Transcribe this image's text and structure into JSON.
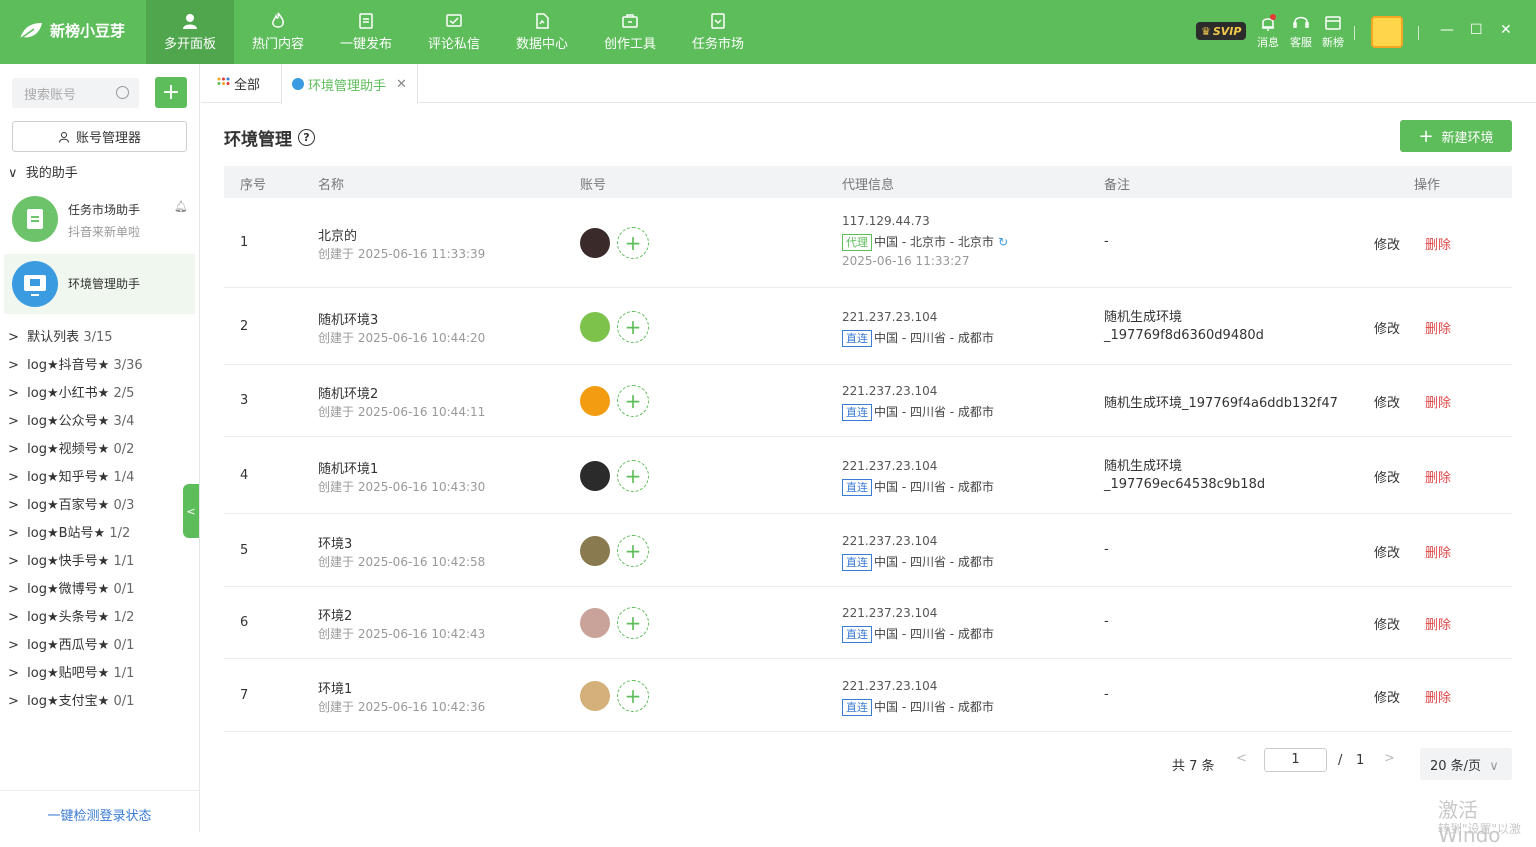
{
  "app": {
    "name": "新榜小豆芽"
  },
  "nav": [
    {
      "label": "多开面板",
      "icon": "user-icon",
      "active": true
    },
    {
      "label": "热门内容",
      "icon": "flame-icon"
    },
    {
      "label": "一键发布",
      "icon": "publish-icon"
    },
    {
      "label": "评论私信",
      "icon": "message-icon"
    },
    {
      "label": "数据中心",
      "icon": "data-icon"
    },
    {
      "label": "创作工具",
      "icon": "toolbox-icon"
    },
    {
      "label": "任务市场",
      "icon": "task-icon"
    }
  ],
  "topright": {
    "svip": "SVIP",
    "msg": "消息",
    "service": "客服",
    "newbang": "新榜"
  },
  "sidebar": {
    "search_placeholder": "搜索账号",
    "add": "+",
    "account_manager": "账号管理器",
    "my_helpers": "我的助手",
    "helpers": [
      {
        "title": "任务市场助手",
        "subtitle": "抖音来新单啦"
      },
      {
        "title": "环境管理助手",
        "subtitle": ""
      }
    ],
    "groups": [
      {
        "name": "默认列表",
        "count": "3/15"
      },
      {
        "name": "log★抖音号★",
        "count": "3/36"
      },
      {
        "name": "log★小红书★",
        "count": "2/5"
      },
      {
        "name": "log★公众号★",
        "count": "3/4"
      },
      {
        "name": "log★视频号★",
        "count": "0/2"
      },
      {
        "name": "log★知乎号★",
        "count": "1/4"
      },
      {
        "name": "log★百家号★",
        "count": "0/3"
      },
      {
        "name": "log★B站号★",
        "count": "1/2"
      },
      {
        "name": "log★快手号★",
        "count": "1/1"
      },
      {
        "name": "log★微博号★",
        "count": "0/1"
      },
      {
        "name": "log★头条号★",
        "count": "1/2"
      },
      {
        "name": "log★西瓜号★",
        "count": "0/1"
      },
      {
        "name": "log★贴吧号★",
        "count": "1/1"
      },
      {
        "name": "log★支付宝★",
        "count": "0/1"
      }
    ],
    "footer": "一键检测登录状态"
  },
  "tabs": {
    "all": "全部",
    "env": "环境管理助手"
  },
  "page": {
    "title": "环境管理",
    "new_button": "新建环境"
  },
  "table": {
    "headers": [
      "序号",
      "名称",
      "账号",
      "代理信息",
      "备注",
      "操作"
    ],
    "edit": "修改",
    "delete": "删除",
    "rows": [
      {
        "no": "1",
        "name": "北京的",
        "created": "创建于 2025-06-16 11:33:39",
        "ip": "117.129.44.73",
        "tag": "代理",
        "loc": "中国 - 北京市 - 北京市",
        "ptime": "2025-06-16 11:33:27",
        "note": "-",
        "note2": ""
      },
      {
        "no": "2",
        "name": "随机环境3",
        "created": "创建于 2025-06-16 10:44:20",
        "ip": "221.237.23.104",
        "tag": "直连",
        "loc": "中国 - 四川省 - 成都市",
        "ptime": "",
        "note": "随机生成环境",
        "note2": "_197769f8d6360d9480d"
      },
      {
        "no": "3",
        "name": "随机环境2",
        "created": "创建于 2025-06-16 10:44:11",
        "ip": "221.237.23.104",
        "tag": "直连",
        "loc": "中国 - 四川省 - 成都市",
        "ptime": "",
        "note": "随机生成环境_197769f4a6ddb132f47",
        "note2": ""
      },
      {
        "no": "4",
        "name": "随机环境1",
        "created": "创建于 2025-06-16 10:43:30",
        "ip": "221.237.23.104",
        "tag": "直连",
        "loc": "中国 - 四川省 - 成都市",
        "ptime": "",
        "note": "随机生成环境",
        "note2": "_197769ec64538c9b18d"
      },
      {
        "no": "5",
        "name": "环境3",
        "created": "创建于 2025-06-16 10:42:58",
        "ip": "221.237.23.104",
        "tag": "直连",
        "loc": "中国 - 四川省 - 成都市",
        "ptime": "",
        "note": "-",
        "note2": ""
      },
      {
        "no": "6",
        "name": "环境2",
        "created": "创建于 2025-06-16 10:42:43",
        "ip": "221.237.23.104",
        "tag": "直连",
        "loc": "中国 - 四川省 - 成都市",
        "ptime": "",
        "note": "-",
        "note2": ""
      },
      {
        "no": "7",
        "name": "环境1",
        "created": "创建于 2025-06-16 10:42:36",
        "ip": "221.237.23.104",
        "tag": "直连",
        "loc": "中国 - 四川省 - 成都市",
        "ptime": "",
        "note": "-",
        "note2": ""
      }
    ]
  },
  "pager": {
    "total": "共 7 条",
    "page": "1",
    "slash": "/",
    "pages": "1",
    "size": "20 条/页"
  },
  "watermark": {
    "line1": "激活 Windo",
    "line2": "转到\"设置\"以激"
  }
}
